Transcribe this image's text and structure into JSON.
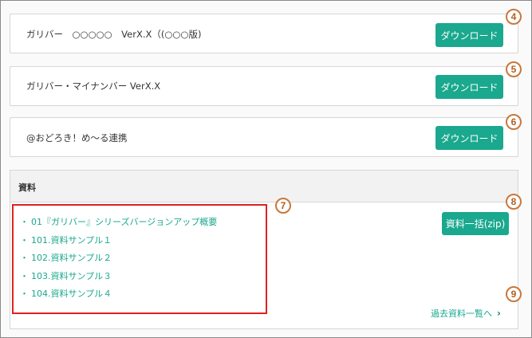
{
  "products": [
    {
      "title": "ガリバー　○○○○○　VerX.X（(○○○版)",
      "button": "ダウンロード",
      "badge": "4"
    },
    {
      "title": "ガリバー・マイナンバー VerX.X",
      "button": "ダウンロード",
      "badge": "5"
    },
    {
      "title": "@おどろき！め～る連携",
      "button": "ダウンロード",
      "badge": "6"
    }
  ],
  "materials": {
    "header": "資料",
    "bundle_button": "資料一括(zip)",
    "badge_list": "7",
    "badge_bundle": "8",
    "badge_past": "9",
    "items": [
      "01『ガリバー』シリーズバージョンアップ概要",
      "101.資料サンプル１",
      "102.資料サンプル２",
      "103.資料サンプル３",
      "104.資料サンプル４"
    ],
    "bullet": "・",
    "past_link": "過去資料一覧へ",
    "past_chevron": "›"
  },
  "colors": {
    "accent": "#1aa88e",
    "highlight": "#e02020",
    "badge": "#c8783c"
  }
}
